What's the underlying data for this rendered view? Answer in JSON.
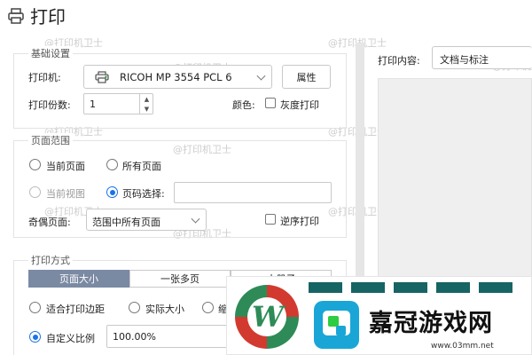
{
  "window": {
    "title": "打印"
  },
  "basic": {
    "group_label": "基础设置",
    "printer_label": "打印机:",
    "printer_value": "RICOH MP 3554 PCL 6",
    "properties_button": "属性",
    "copies_label": "打印份数:",
    "copies_value": "1",
    "color_label": "颜色:",
    "grayscale_label": "灰度打印"
  },
  "page_range": {
    "group_label": "页面范围",
    "current_page": "当前页面",
    "all_pages": "所有页面",
    "current_view": "当前视图",
    "page_selection": "页码选择:",
    "odd_even_label": "奇偶页面:",
    "odd_even_value": "范围中所有页面",
    "reverse_label": "逆序打印"
  },
  "print_mode": {
    "group_label": "打印方式",
    "tabs": [
      "页面大小",
      "一张多页",
      "小册子"
    ],
    "fit_margin": "适合打印边距",
    "actual_size": "实际大小",
    "shrink": "缩",
    "custom_scale": "自定义比例",
    "scale_value": "100.00%"
  },
  "preview": {
    "content_label": "打印内容:",
    "content_value": "文档与标注"
  },
  "watermark": {
    "text": "@打印机卫士"
  },
  "overlay": {
    "logo_letter": "W",
    "brand_title": "嘉冠游戏网",
    "brand_url": "www.03mm.net"
  },
  "colors": {
    "accent": "#1a73e8",
    "tab_active": "#7b8aa3",
    "brand_red": "#d23a2f",
    "brand_green": "#2e8b57"
  }
}
